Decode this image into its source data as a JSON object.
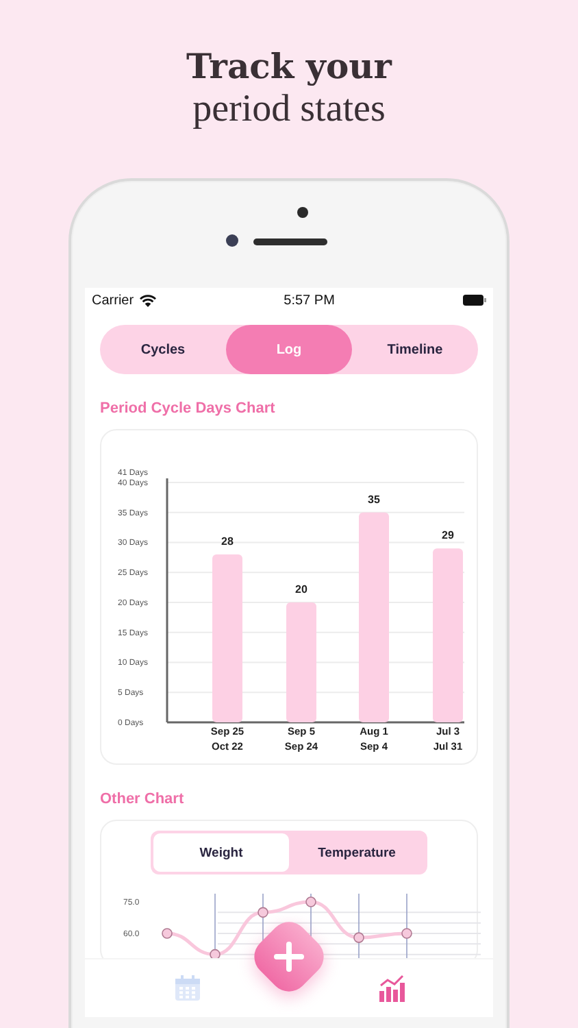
{
  "headline": {
    "title": "Track your",
    "subtitle": "period states"
  },
  "status_bar": {
    "carrier": "Carrier",
    "time": "5:57 PM"
  },
  "tabs": [
    {
      "label": "Cycles",
      "selected": false
    },
    {
      "label": "Log",
      "selected": true
    },
    {
      "label": "Timeline",
      "selected": false
    }
  ],
  "cycle_chart": {
    "heading": "Period Cycle Days Chart",
    "chart_data": {
      "type": "bar",
      "categories": [
        "Sep 25\nOct 22",
        "Sep 5\nSep 24",
        "Aug 1\nSep 4",
        "Jul 3\nJul 31"
      ],
      "series": [
        {
          "color": "#fdd0e4",
          "values": [
            28,
            20,
            35,
            29
          ]
        }
      ],
      "grid": true,
      "ylim": [
        0,
        41
      ],
      "yticks": [
        {
          "value": 0,
          "label": "0 Days"
        },
        {
          "value": 5,
          "label": "5 Days"
        },
        {
          "value": 10,
          "label": "10 Days"
        },
        {
          "value": 15,
          "label": "15 Days"
        },
        {
          "value": 20,
          "label": "20 Days"
        },
        {
          "value": 25,
          "label": "25 Days"
        },
        {
          "value": 30,
          "label": "30 Days"
        },
        {
          "value": 35,
          "label": "35 Days"
        },
        {
          "value": 40,
          "label": "40 Days"
        },
        {
          "value": 41,
          "label": "41 Days"
        }
      ],
      "data_labels": true
    }
  },
  "other_chart": {
    "heading": "Other Chart",
    "segments": [
      {
        "label": "Weight",
        "selected": true
      },
      {
        "label": "Temperature",
        "selected": false
      }
    ],
    "axis_labels": [
      "75.0",
      "60.0"
    ]
  },
  "nav": [
    {
      "kind": "calendar",
      "selected": false
    },
    {
      "kind": "stats",
      "selected": true
    }
  ]
}
